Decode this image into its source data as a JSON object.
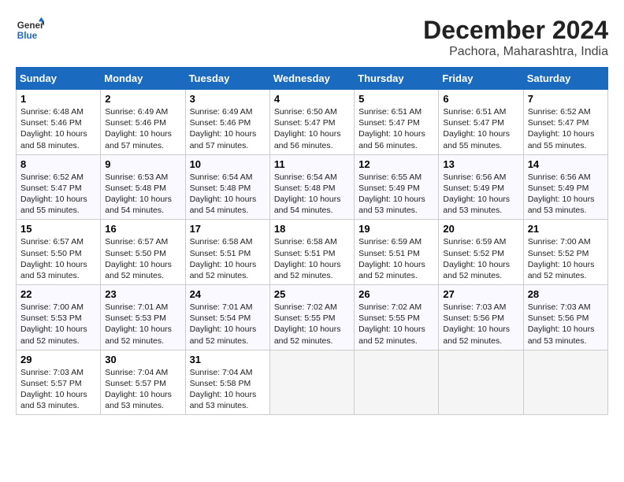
{
  "header": {
    "logo_general": "General",
    "logo_blue": "Blue",
    "month_year": "December 2024",
    "location": "Pachora, Maharashtra, India"
  },
  "days_of_week": [
    "Sunday",
    "Monday",
    "Tuesday",
    "Wednesday",
    "Thursday",
    "Friday",
    "Saturday"
  ],
  "weeks": [
    [
      {
        "day": "1",
        "sunrise": "6:48 AM",
        "sunset": "5:46 PM",
        "daylight": "10 hours and 58 minutes."
      },
      {
        "day": "2",
        "sunrise": "6:49 AM",
        "sunset": "5:46 PM",
        "daylight": "10 hours and 57 minutes."
      },
      {
        "day": "3",
        "sunrise": "6:49 AM",
        "sunset": "5:46 PM",
        "daylight": "10 hours and 57 minutes."
      },
      {
        "day": "4",
        "sunrise": "6:50 AM",
        "sunset": "5:47 PM",
        "daylight": "10 hours and 56 minutes."
      },
      {
        "day": "5",
        "sunrise": "6:51 AM",
        "sunset": "5:47 PM",
        "daylight": "10 hours and 56 minutes."
      },
      {
        "day": "6",
        "sunrise": "6:51 AM",
        "sunset": "5:47 PM",
        "daylight": "10 hours and 55 minutes."
      },
      {
        "day": "7",
        "sunrise": "6:52 AM",
        "sunset": "5:47 PM",
        "daylight": "10 hours and 55 minutes."
      }
    ],
    [
      {
        "day": "8",
        "sunrise": "6:52 AM",
        "sunset": "5:47 PM",
        "daylight": "10 hours and 55 minutes."
      },
      {
        "day": "9",
        "sunrise": "6:53 AM",
        "sunset": "5:48 PM",
        "daylight": "10 hours and 54 minutes."
      },
      {
        "day": "10",
        "sunrise": "6:54 AM",
        "sunset": "5:48 PM",
        "daylight": "10 hours and 54 minutes."
      },
      {
        "day": "11",
        "sunrise": "6:54 AM",
        "sunset": "5:48 PM",
        "daylight": "10 hours and 54 minutes."
      },
      {
        "day": "12",
        "sunrise": "6:55 AM",
        "sunset": "5:49 PM",
        "daylight": "10 hours and 53 minutes."
      },
      {
        "day": "13",
        "sunrise": "6:56 AM",
        "sunset": "5:49 PM",
        "daylight": "10 hours and 53 minutes."
      },
      {
        "day": "14",
        "sunrise": "6:56 AM",
        "sunset": "5:49 PM",
        "daylight": "10 hours and 53 minutes."
      }
    ],
    [
      {
        "day": "15",
        "sunrise": "6:57 AM",
        "sunset": "5:50 PM",
        "daylight": "10 hours and 53 minutes."
      },
      {
        "day": "16",
        "sunrise": "6:57 AM",
        "sunset": "5:50 PM",
        "daylight": "10 hours and 52 minutes."
      },
      {
        "day": "17",
        "sunrise": "6:58 AM",
        "sunset": "5:51 PM",
        "daylight": "10 hours and 52 minutes."
      },
      {
        "day": "18",
        "sunrise": "6:58 AM",
        "sunset": "5:51 PM",
        "daylight": "10 hours and 52 minutes."
      },
      {
        "day": "19",
        "sunrise": "6:59 AM",
        "sunset": "5:51 PM",
        "daylight": "10 hours and 52 minutes."
      },
      {
        "day": "20",
        "sunrise": "6:59 AM",
        "sunset": "5:52 PM",
        "daylight": "10 hours and 52 minutes."
      },
      {
        "day": "21",
        "sunrise": "7:00 AM",
        "sunset": "5:52 PM",
        "daylight": "10 hours and 52 minutes."
      }
    ],
    [
      {
        "day": "22",
        "sunrise": "7:00 AM",
        "sunset": "5:53 PM",
        "daylight": "10 hours and 52 minutes."
      },
      {
        "day": "23",
        "sunrise": "7:01 AM",
        "sunset": "5:53 PM",
        "daylight": "10 hours and 52 minutes."
      },
      {
        "day": "24",
        "sunrise": "7:01 AM",
        "sunset": "5:54 PM",
        "daylight": "10 hours and 52 minutes."
      },
      {
        "day": "25",
        "sunrise": "7:02 AM",
        "sunset": "5:55 PM",
        "daylight": "10 hours and 52 minutes."
      },
      {
        "day": "26",
        "sunrise": "7:02 AM",
        "sunset": "5:55 PM",
        "daylight": "10 hours and 52 minutes."
      },
      {
        "day": "27",
        "sunrise": "7:03 AM",
        "sunset": "5:56 PM",
        "daylight": "10 hours and 52 minutes."
      },
      {
        "day": "28",
        "sunrise": "7:03 AM",
        "sunset": "5:56 PM",
        "daylight": "10 hours and 53 minutes."
      }
    ],
    [
      {
        "day": "29",
        "sunrise": "7:03 AM",
        "sunset": "5:57 PM",
        "daylight": "10 hours and 53 minutes."
      },
      {
        "day": "30",
        "sunrise": "7:04 AM",
        "sunset": "5:57 PM",
        "daylight": "10 hours and 53 minutes."
      },
      {
        "day": "31",
        "sunrise": "7:04 AM",
        "sunset": "5:58 PM",
        "daylight": "10 hours and 53 minutes."
      },
      null,
      null,
      null,
      null
    ]
  ]
}
